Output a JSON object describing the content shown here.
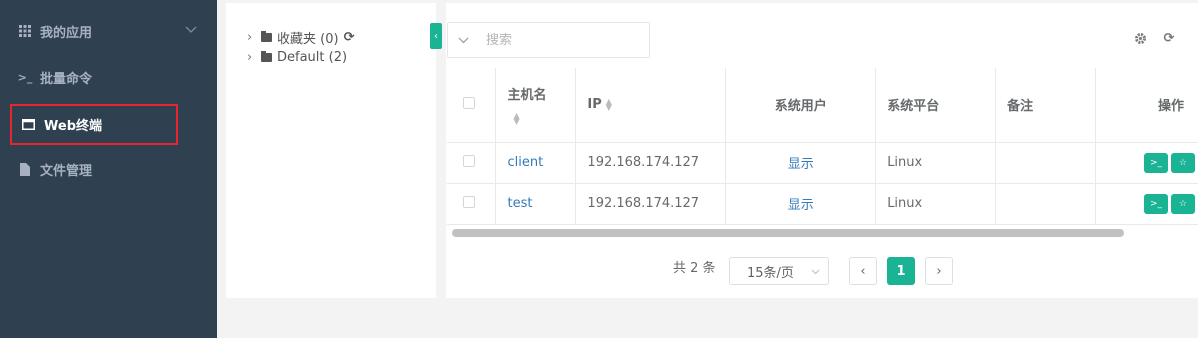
{
  "sidebar": {
    "items": [
      {
        "label": "我的应用",
        "icon": "grid-icon"
      },
      {
        "label": "批量命令",
        "icon": "terminal-icon"
      },
      {
        "label": "Web终端",
        "icon": "window-icon",
        "active": true
      },
      {
        "label": "文件管理",
        "icon": "file-icon"
      }
    ]
  },
  "tree": {
    "nodes": [
      {
        "label": "收藏夹 (0)"
      },
      {
        "label": "Default (2)"
      }
    ]
  },
  "search": {
    "placeholder": "搜索"
  },
  "table": {
    "headers": [
      "主机名",
      "IP",
      "系统用户",
      "系统平台",
      "备注",
      "操作"
    ],
    "rows": [
      {
        "hostname": "client",
        "ip": "192.168.174.127",
        "user": "显示",
        "platform": "Linux",
        "note": ""
      },
      {
        "hostname": "test",
        "ip": "192.168.174.127",
        "user": "显示",
        "platform": "Linux",
        "note": ""
      }
    ]
  },
  "pagination": {
    "total": "共 2 条",
    "page_size": "15条/页",
    "current_page": "1"
  },
  "colors": {
    "accent": "#1ab394",
    "sidebar_bg": "#2f4050",
    "active_border": "#e8262b",
    "link": "#337ab7"
  }
}
